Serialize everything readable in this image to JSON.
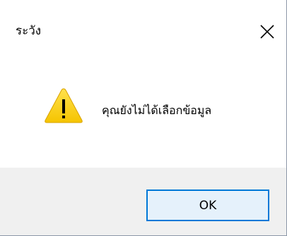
{
  "dialog": {
    "title": "ระวัง",
    "message": "คุณยังไม่ได้เลือกข้อมูล",
    "ok_label": "OK"
  },
  "icons": {
    "close": "close-icon",
    "warning": "warning-icon"
  },
  "colors": {
    "accent_border": "#0078d7",
    "button_face": "#e5f1fb",
    "footer_bg": "#f0f0f0",
    "warning_fill": "#fcd116"
  }
}
